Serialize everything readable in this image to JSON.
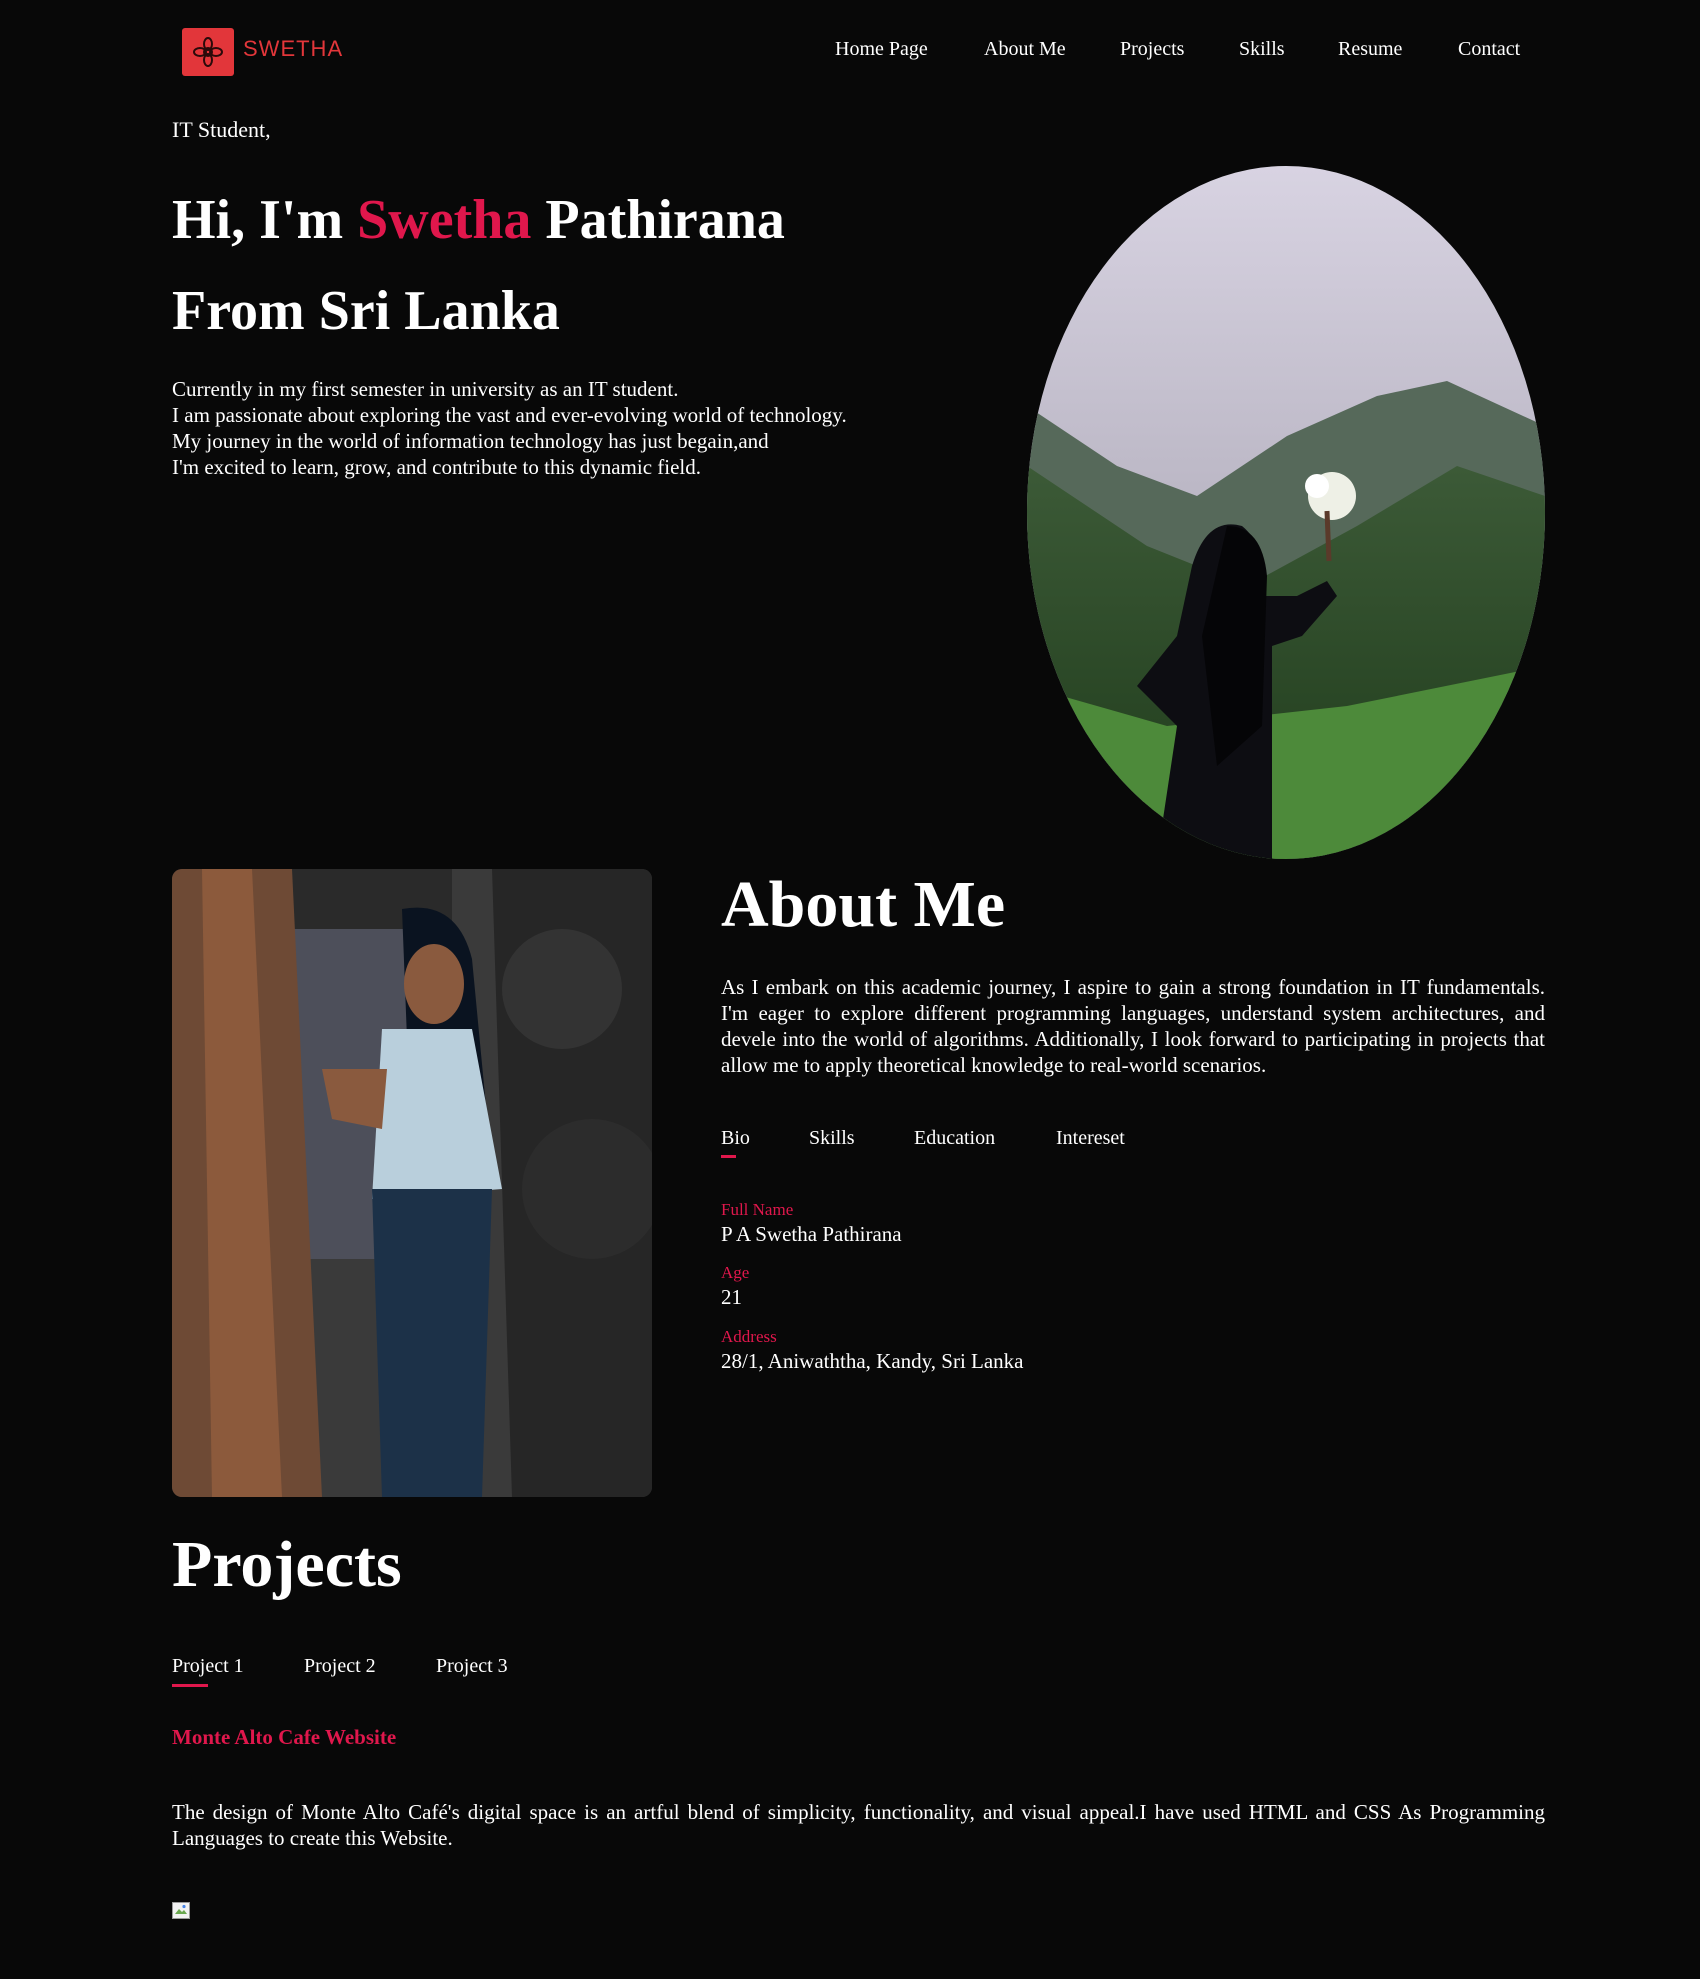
{
  "header": {
    "logo_text": "SWETHA",
    "nav": [
      "Home Page",
      "About Me",
      "Projects",
      "Skills",
      "Resume",
      "Contact"
    ]
  },
  "hero": {
    "kicker": "IT Student,",
    "title_pre": "Hi, I'm ",
    "title_accent": "Swetha",
    "title_post": " Pathirana",
    "subtitle": "From Sri Lanka",
    "description": [
      "Currently in my first semester in university as an IT student.",
      "I am passionate about exploring the vast and ever-evolving world of technology.",
      "My journey in the world of information technology has just begain,and",
      "I'm excited to learn, grow, and contribute to this dynamic field."
    ]
  },
  "about": {
    "title": "About Me",
    "text": "As I embark on this academic journey, I aspire to gain a strong foundation in IT fundamentals. I'm eager to explore different programming languages, understand system architectures, and devele into the world of algorithms. Additionally, I look forward to participating in projects that allow me to apply theoretical knowledge to real-world scenarios.",
    "tabs": [
      "Bio",
      "Skills",
      "Education",
      "Intereset"
    ],
    "active_tab": "Bio",
    "fields": [
      {
        "label": "Full Name",
        "value": "P A Swetha Pathirana"
      },
      {
        "label": "Age",
        "value": "21"
      },
      {
        "label": "Address",
        "value": "28/1, Aniwaththa, Kandy, Sri Lanka"
      }
    ]
  },
  "projects": {
    "title": "Projects",
    "tabs": [
      "Project 1",
      "Project 2",
      "Project 3"
    ],
    "active_tab": "Project 1",
    "name": "Monte Alto Cafe Website",
    "description": "The design of Monte Alto Café's digital space is an artful blend of simplicity, functionality, and visual appeal.I have used HTML and CSS As Programming Languages to create this Website."
  },
  "colors": {
    "background": "#080808",
    "accent": "#e0174c",
    "logo": "#e2363a",
    "text": "#ffffff"
  },
  "icons": [
    "flower-logo-icon",
    "broken-image-icon"
  ]
}
